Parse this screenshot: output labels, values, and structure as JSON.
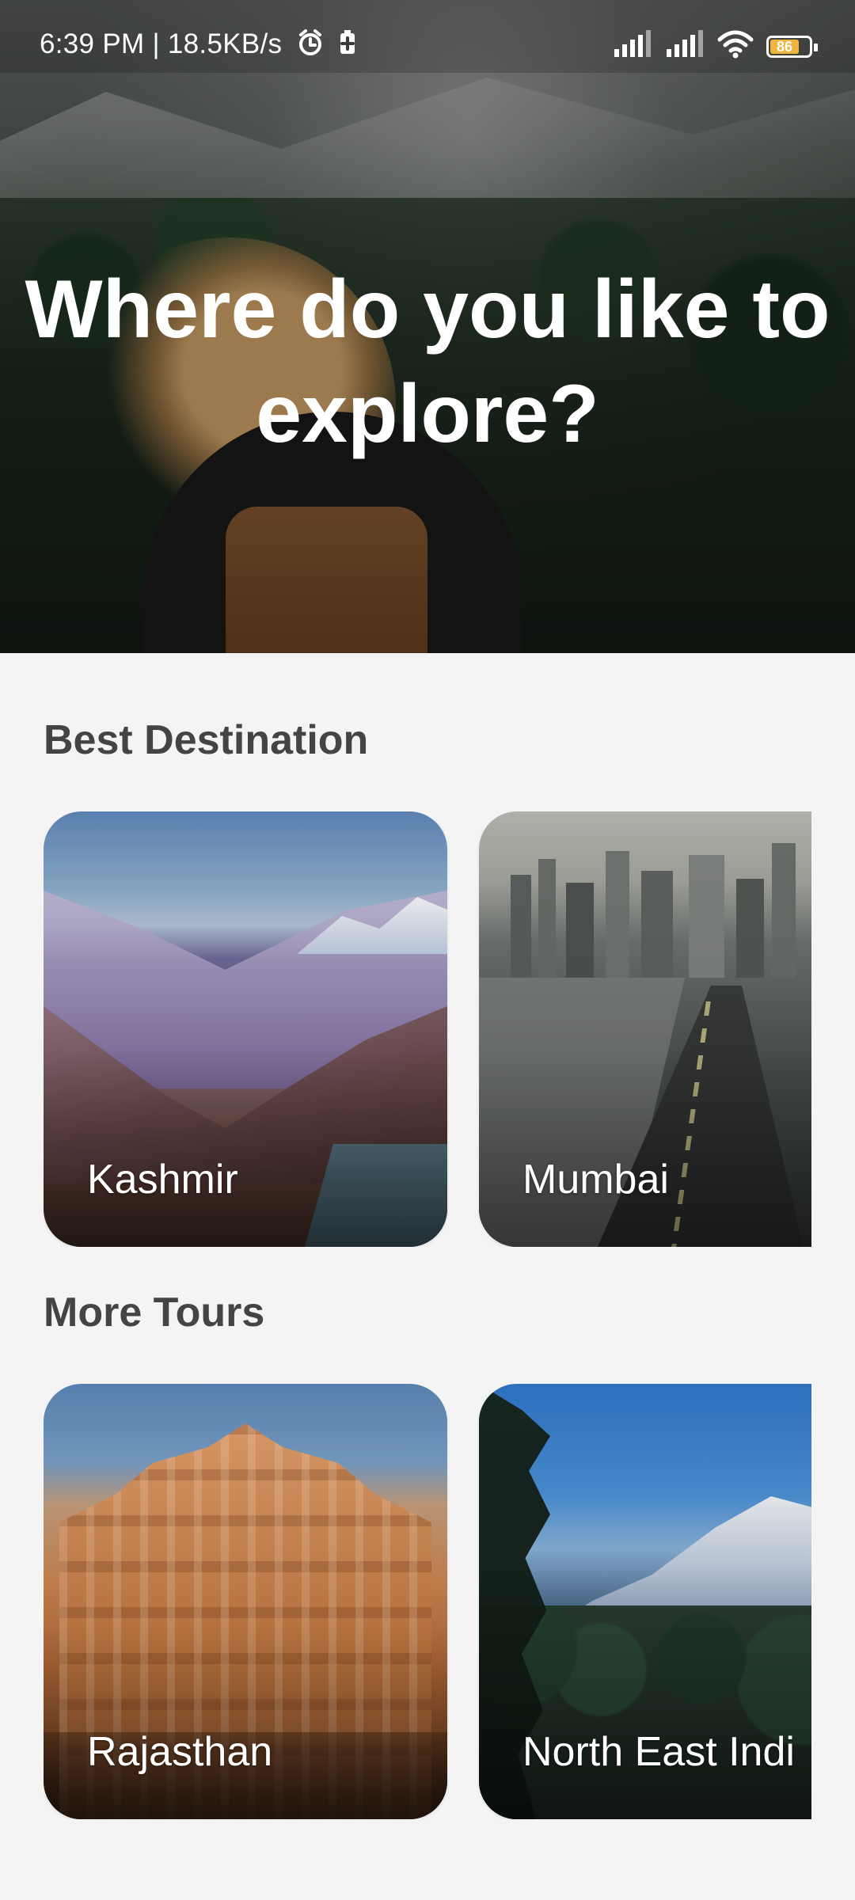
{
  "status_bar": {
    "time_and_speed": "6:39 PM | 18.5KB/s",
    "battery_level": "86",
    "icons": [
      "alarm-icon",
      "battery-saver-icon",
      "signal-icon",
      "signal-icon",
      "wifi-icon",
      "battery-icon"
    ]
  },
  "hero": {
    "title": "Where do you like to explore?"
  },
  "sections": {
    "best": {
      "title": "Best Destination",
      "cards": [
        {
          "name": "Kashmir"
        },
        {
          "name": "Mumbai"
        }
      ]
    },
    "more": {
      "title": "More Tours",
      "cards": [
        {
          "name": "Rajasthan"
        },
        {
          "name": "North East Indi"
        }
      ]
    }
  }
}
